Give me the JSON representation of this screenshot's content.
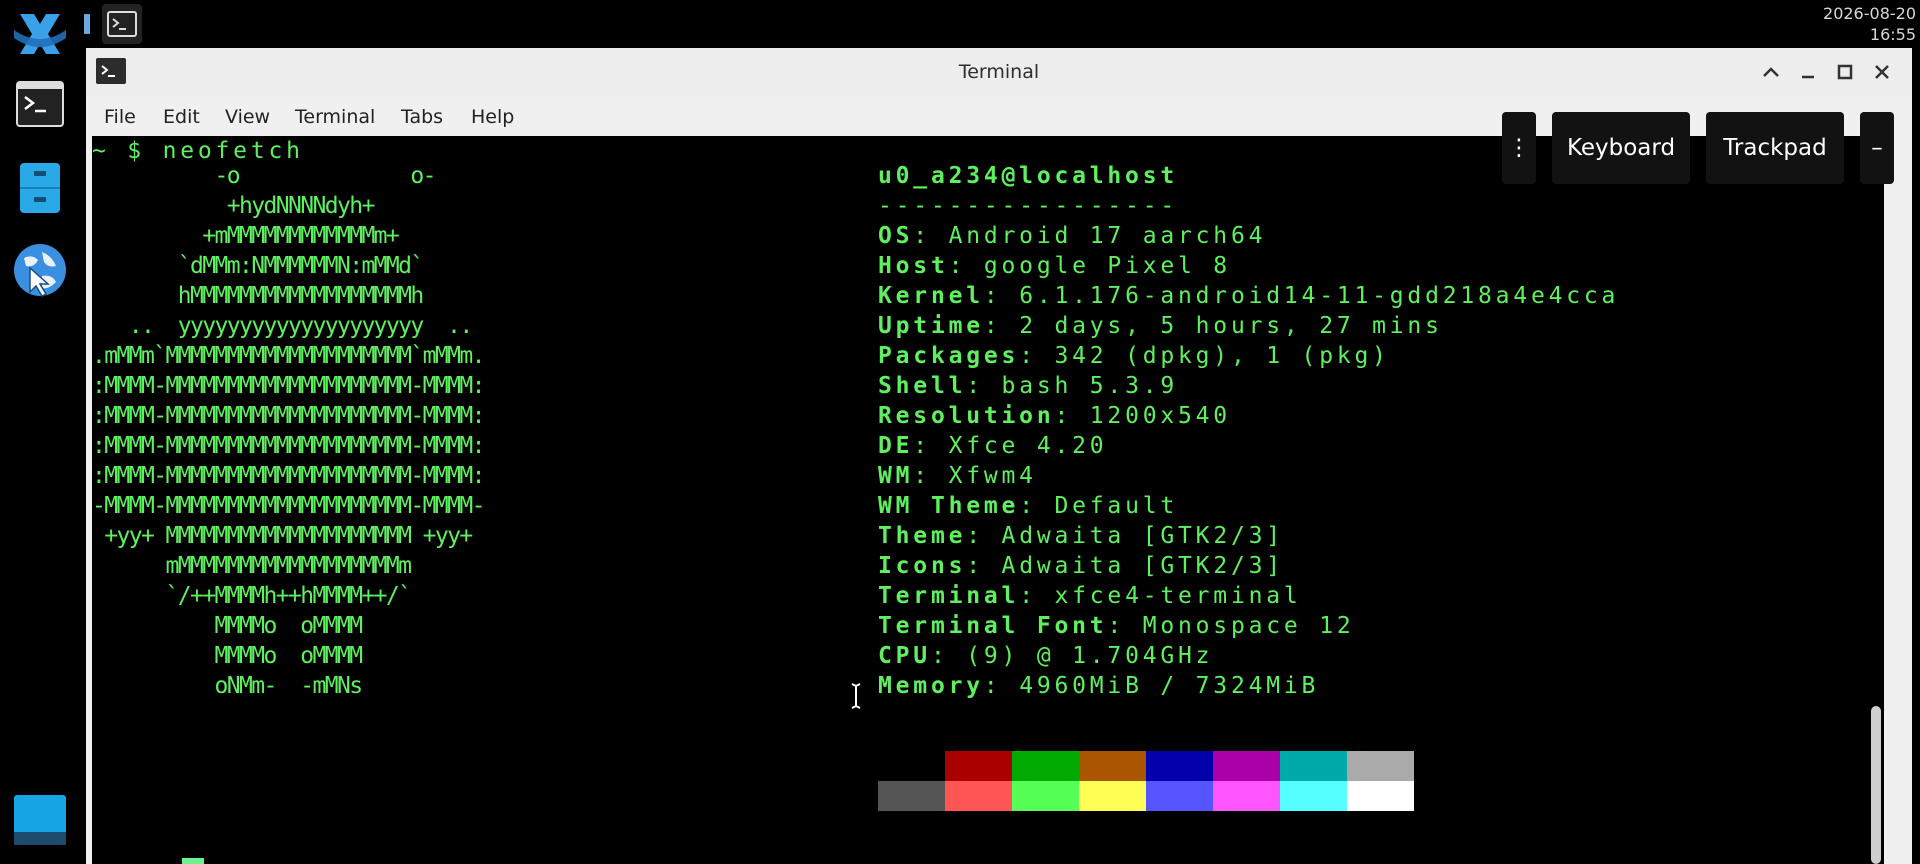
{
  "panel": {
    "clock_date": "2026-08-20",
    "clock_time": "16:55"
  },
  "dock": {
    "items": [
      {
        "icon": "xfce-logo-icon"
      },
      {
        "icon": "terminal-icon"
      },
      {
        "icon": "file-cabinet-icon"
      },
      {
        "icon": "web-browser-icon"
      },
      {
        "icon": "show-desktop-icon"
      }
    ]
  },
  "window": {
    "title": "Terminal",
    "menu": [
      "File",
      "Edit",
      "View",
      "Terminal",
      "Tabs",
      "Help"
    ]
  },
  "overlay": {
    "more_label": "⋮",
    "keyboard_label": "Keyboard",
    "trackpad_label": "Trackpad",
    "collapse_label": "–"
  },
  "terminal": {
    "prompt": "~ $ neofetch",
    "ascii_art": [
      "          -o              o-",
      "           +hydNNNNdyh+",
      "         +mMMMMMMMMMMMMm+",
      "       `dMMm:NMMMMMMN:mMMd`",
      "       hMMMMMMMMMMMMMMMMMMh",
      "   ..  yyyyyyyyyyyyyyyyyyyy  ..",
      ".mMMm`MMMMMMMMMMMMMMMMMMMM`mMMm.",
      ":MMMM-MMMMMMMMMMMMMMMMMMMM-MMMM:",
      ":MMMM-MMMMMMMMMMMMMMMMMMMM-MMMM:",
      ":MMMM-MMMMMMMMMMMMMMMMMMMM-MMMM:",
      ":MMMM-MMMMMMMMMMMMMMMMMMMM-MMMM:",
      "-MMMM-MMMMMMMMMMMMMMMMMMMM-MMMM-",
      " +yy+ MMMMMMMMMMMMMMMMMMMM +yy+",
      "      mMMMMMMMMMMMMMMMMMMm",
      "      `/++MMMMh++hMMMM++/`",
      "          MMMMo  oMMMM",
      "          MMMMo  oMMMM",
      "          oNMm-  -mMNs"
    ],
    "user_host": "u0_a234@localhost",
    "separator": "-----------------",
    "info": [
      {
        "key": "OS",
        "value": "Android 17 aarch64"
      },
      {
        "key": "Host",
        "value": "google Pixel 8"
      },
      {
        "key": "Kernel",
        "value": "6.1.176-android14-11-gdd218a4e4cca"
      },
      {
        "key": "Uptime",
        "value": "2 days, 5 hours, 27 mins"
      },
      {
        "key": "Packages",
        "value": "342 (dpkg), 1 (pkg)"
      },
      {
        "key": "Shell",
        "value": "bash 5.3.9"
      },
      {
        "key": "Resolution",
        "value": "1200x540"
      },
      {
        "key": "DE",
        "value": "Xfce 4.20"
      },
      {
        "key": "WM",
        "value": "Xfwm4"
      },
      {
        "key": "WM Theme",
        "value": "Default"
      },
      {
        "key": "Theme",
        "value": "Adwaita [GTK2/3]"
      },
      {
        "key": "Icons",
        "value": "Adwaita [GTK2/3]"
      },
      {
        "key": "Terminal",
        "value": "xfce4-terminal"
      },
      {
        "key": "Terminal Font",
        "value": "Monospace 12"
      },
      {
        "key": "CPU",
        "value": "(9) @ 1.704GHz"
      },
      {
        "key": "Memory",
        "value": "4960MiB / 7324MiB"
      }
    ],
    "palette_row1": [
      "#000000",
      "#aa0000",
      "#00aa00",
      "#aa5500",
      "#0000aa",
      "#aa00aa",
      "#00aaaa",
      "#aaaaaa"
    ],
    "palette_row2": [
      "#555555",
      "#ff5555",
      "#55ff55",
      "#ffff55",
      "#5555ff",
      "#ff55ff",
      "#55ffff",
      "#ffffff"
    ],
    "text_color": "#5ff05f"
  }
}
